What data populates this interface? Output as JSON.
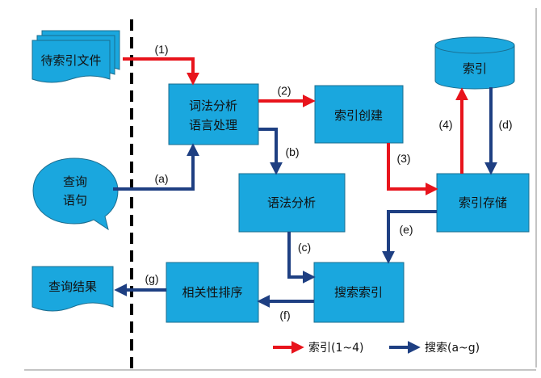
{
  "colors": {
    "node_fill": "#1AA7DE",
    "node_stroke": "#1B6D8F",
    "index_arrow": "#E8141C",
    "search_arrow": "#1E3F82",
    "divider": "#000000"
  },
  "nodes": {
    "pending_files": "待索引文件",
    "lexical_line1": "词法分析",
    "lexical_line2": "语言处理",
    "index_create": "索引创建",
    "index_db": "索引",
    "index_store": "索引存储",
    "query_line1": "查询",
    "query_line2": "语句",
    "syntax": "语法分析",
    "search_index": "搜索索引",
    "ranking": "相关性排序",
    "results": "查询结果"
  },
  "edges": {
    "e1": "(1)",
    "e2": "(2)",
    "e3": "(3)",
    "e4": "(4)",
    "ea": "(a)",
    "eb": "(b)",
    "ec": "(c)",
    "ed": "(d)",
    "ee": "(e)",
    "ef": "(f)",
    "eg": "(g)"
  },
  "legend": {
    "index_label": "索引(1~4)",
    "search_label": "搜索(a~g)"
  }
}
